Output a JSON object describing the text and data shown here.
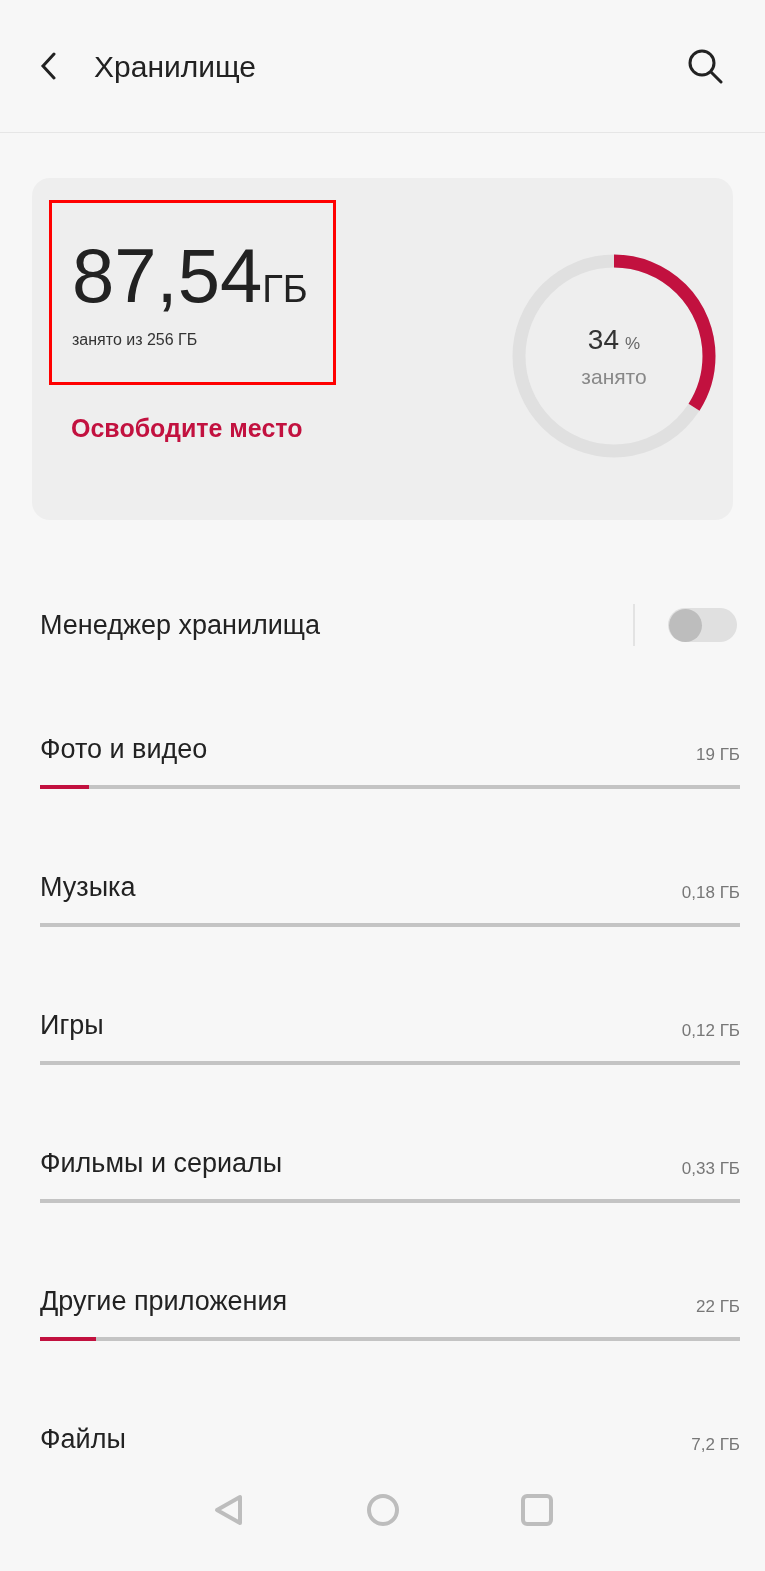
{
  "header": {
    "title": "Хранилище"
  },
  "summary": {
    "used": "87,54",
    "unit": "ГБ",
    "caption": "занято из 256 ГБ",
    "action": "Освободите место",
    "percent": "34",
    "percent_sign": "%",
    "percent_caption": "занято",
    "level": 0.34
  },
  "manager": {
    "label": "Менеджер хранилища",
    "on": false
  },
  "categories": [
    {
      "label": "Фото и видео",
      "size": "19 ГБ",
      "level": 0.07
    },
    {
      "label": "Музыка",
      "size": "0,18 ГБ"
    },
    {
      "label": "Игры",
      "size": "0,12 ГБ"
    },
    {
      "label": "Фильмы и сериалы",
      "size": "0,33 ГБ"
    },
    {
      "label": "Другие приложения",
      "size": "22 ГБ",
      "level": 0.08
    },
    {
      "label": "Файлы",
      "size": "7,2 ГБ",
      "kind": "nobar"
    }
  ]
}
